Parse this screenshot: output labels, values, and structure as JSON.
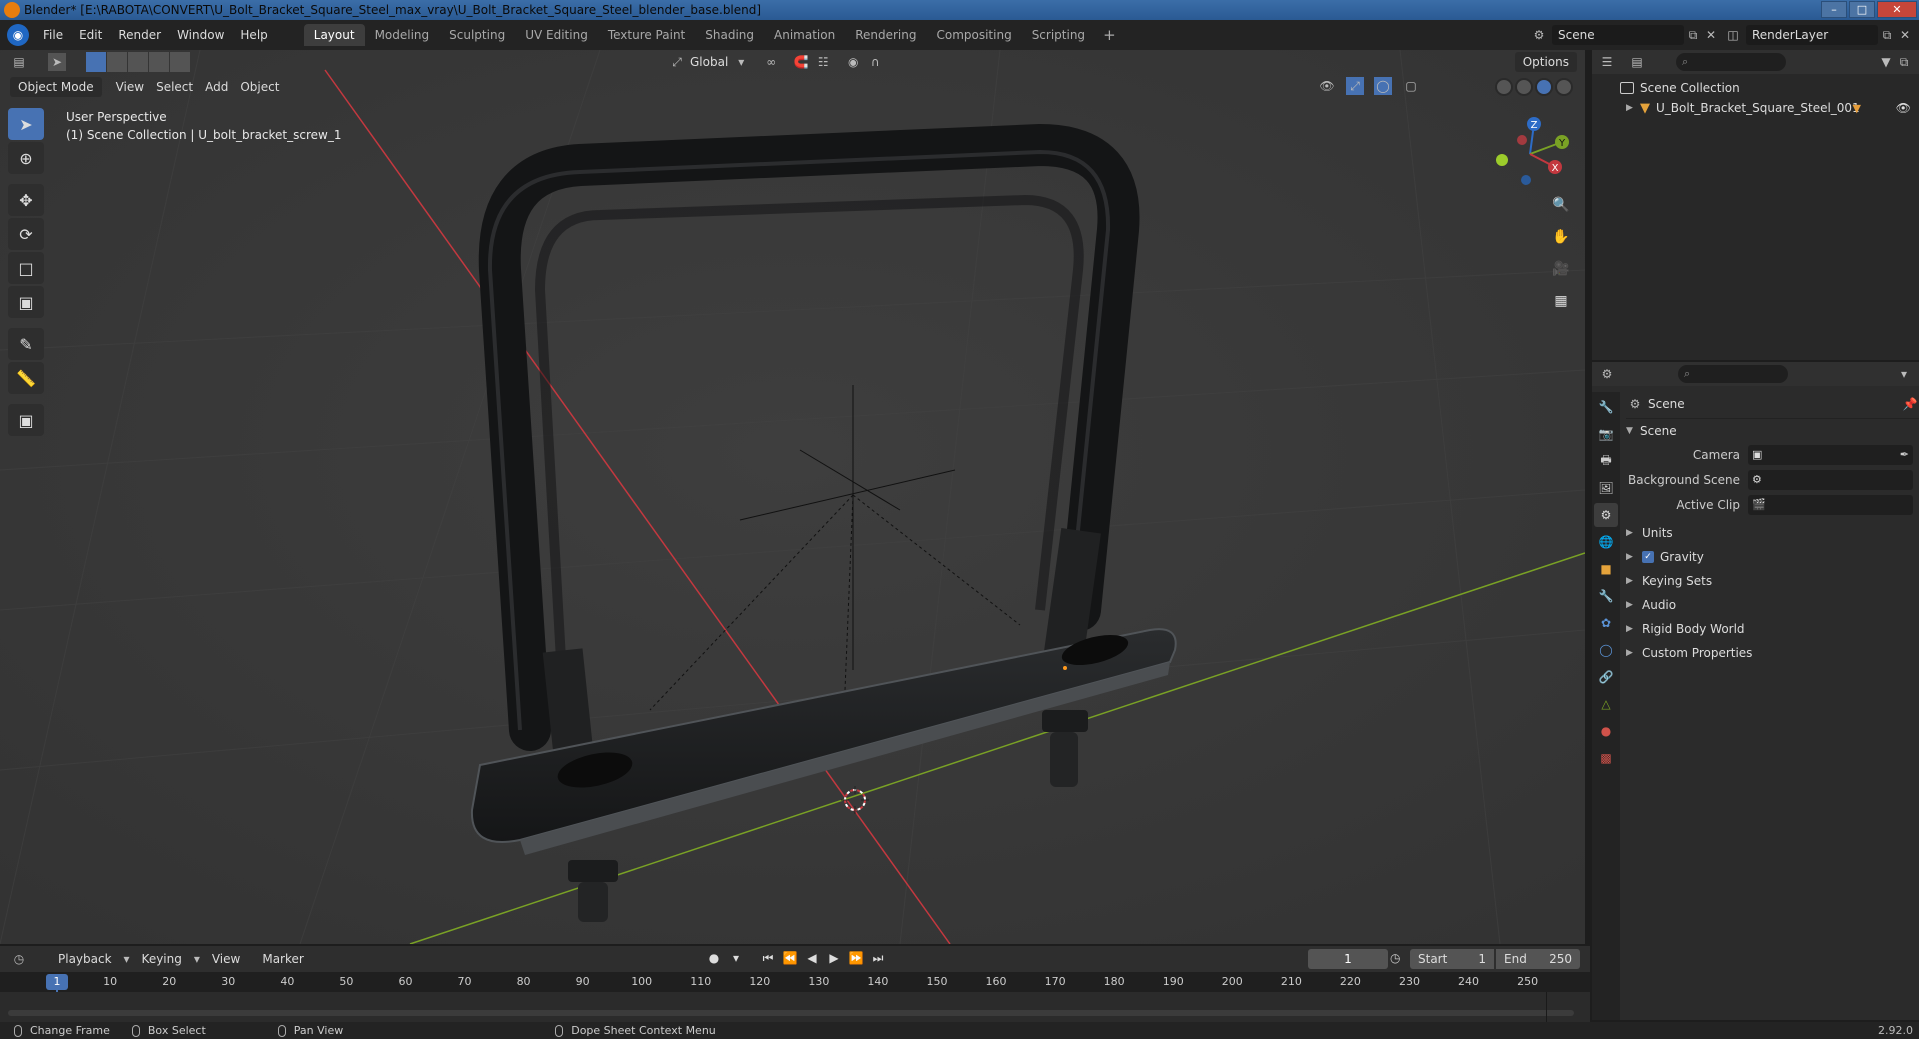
{
  "window": {
    "title": "Blender* [E:\\RABOTA\\CONVERT\\U_Bolt_Bracket_Square_Steel_max_vray\\U_Bolt_Bracket_Square_Steel_blender_base.blend]"
  },
  "menu": [
    "File",
    "Edit",
    "Render",
    "Window",
    "Help"
  ],
  "workspaces": [
    {
      "label": "Layout",
      "active": true
    },
    {
      "label": "Modeling"
    },
    {
      "label": "Sculpting"
    },
    {
      "label": "UV Editing"
    },
    {
      "label": "Texture Paint"
    },
    {
      "label": "Shading"
    },
    {
      "label": "Animation"
    },
    {
      "label": "Rendering"
    },
    {
      "label": "Compositing"
    },
    {
      "label": "Scripting"
    }
  ],
  "scene_selector": "Scene",
  "renderlayer_selector": "RenderLayer",
  "viewport": {
    "mode": "Object Mode",
    "menus": [
      "View",
      "Select",
      "Add",
      "Object"
    ],
    "transform_orientation": "Global",
    "options_label": "Options",
    "info_line1": "User Perspective",
    "info_line2": "(1) Scene Collection | U_bolt_bracket_screw_1",
    "gizmo": {
      "x": "X",
      "y": "Y",
      "z": "Z"
    }
  },
  "outliner": {
    "root": "Scene Collection",
    "items": [
      "U_Bolt_Bracket_Square_Steel_001"
    ]
  },
  "properties": {
    "context_title": "Scene",
    "section": "Scene",
    "fields": [
      {
        "label": "Camera",
        "value": ""
      },
      {
        "label": "Background Scene",
        "value": ""
      },
      {
        "label": "Active Clip",
        "value": ""
      }
    ],
    "subpanels": [
      "Units",
      "Gravity",
      "Keying Sets",
      "Audio",
      "Rigid Body World",
      "Custom Properties"
    ]
  },
  "timeline": {
    "menus": [
      "Playback",
      "Keying",
      "View",
      "Marker"
    ],
    "current_frame": "1",
    "start_label": "Start",
    "start_value": "1",
    "end_label": "End",
    "end_value": "250",
    "ticks": [
      "1",
      "10",
      "20",
      "30",
      "40",
      "50",
      "60",
      "70",
      "80",
      "90",
      "100",
      "110",
      "120",
      "130",
      "140",
      "150",
      "160",
      "170",
      "180",
      "190",
      "200",
      "210",
      "220",
      "230",
      "240",
      "250"
    ]
  },
  "statusbar": {
    "items": [
      "Change Frame",
      "Box Select",
      "Pan View",
      "Dope Sheet Context Menu"
    ],
    "version": "2.92.0"
  },
  "colors": {
    "accent": "#4772b3",
    "x_axis": "#c3383f",
    "y_axis": "#7aa225",
    "z_axis": "#2d6cc7"
  }
}
